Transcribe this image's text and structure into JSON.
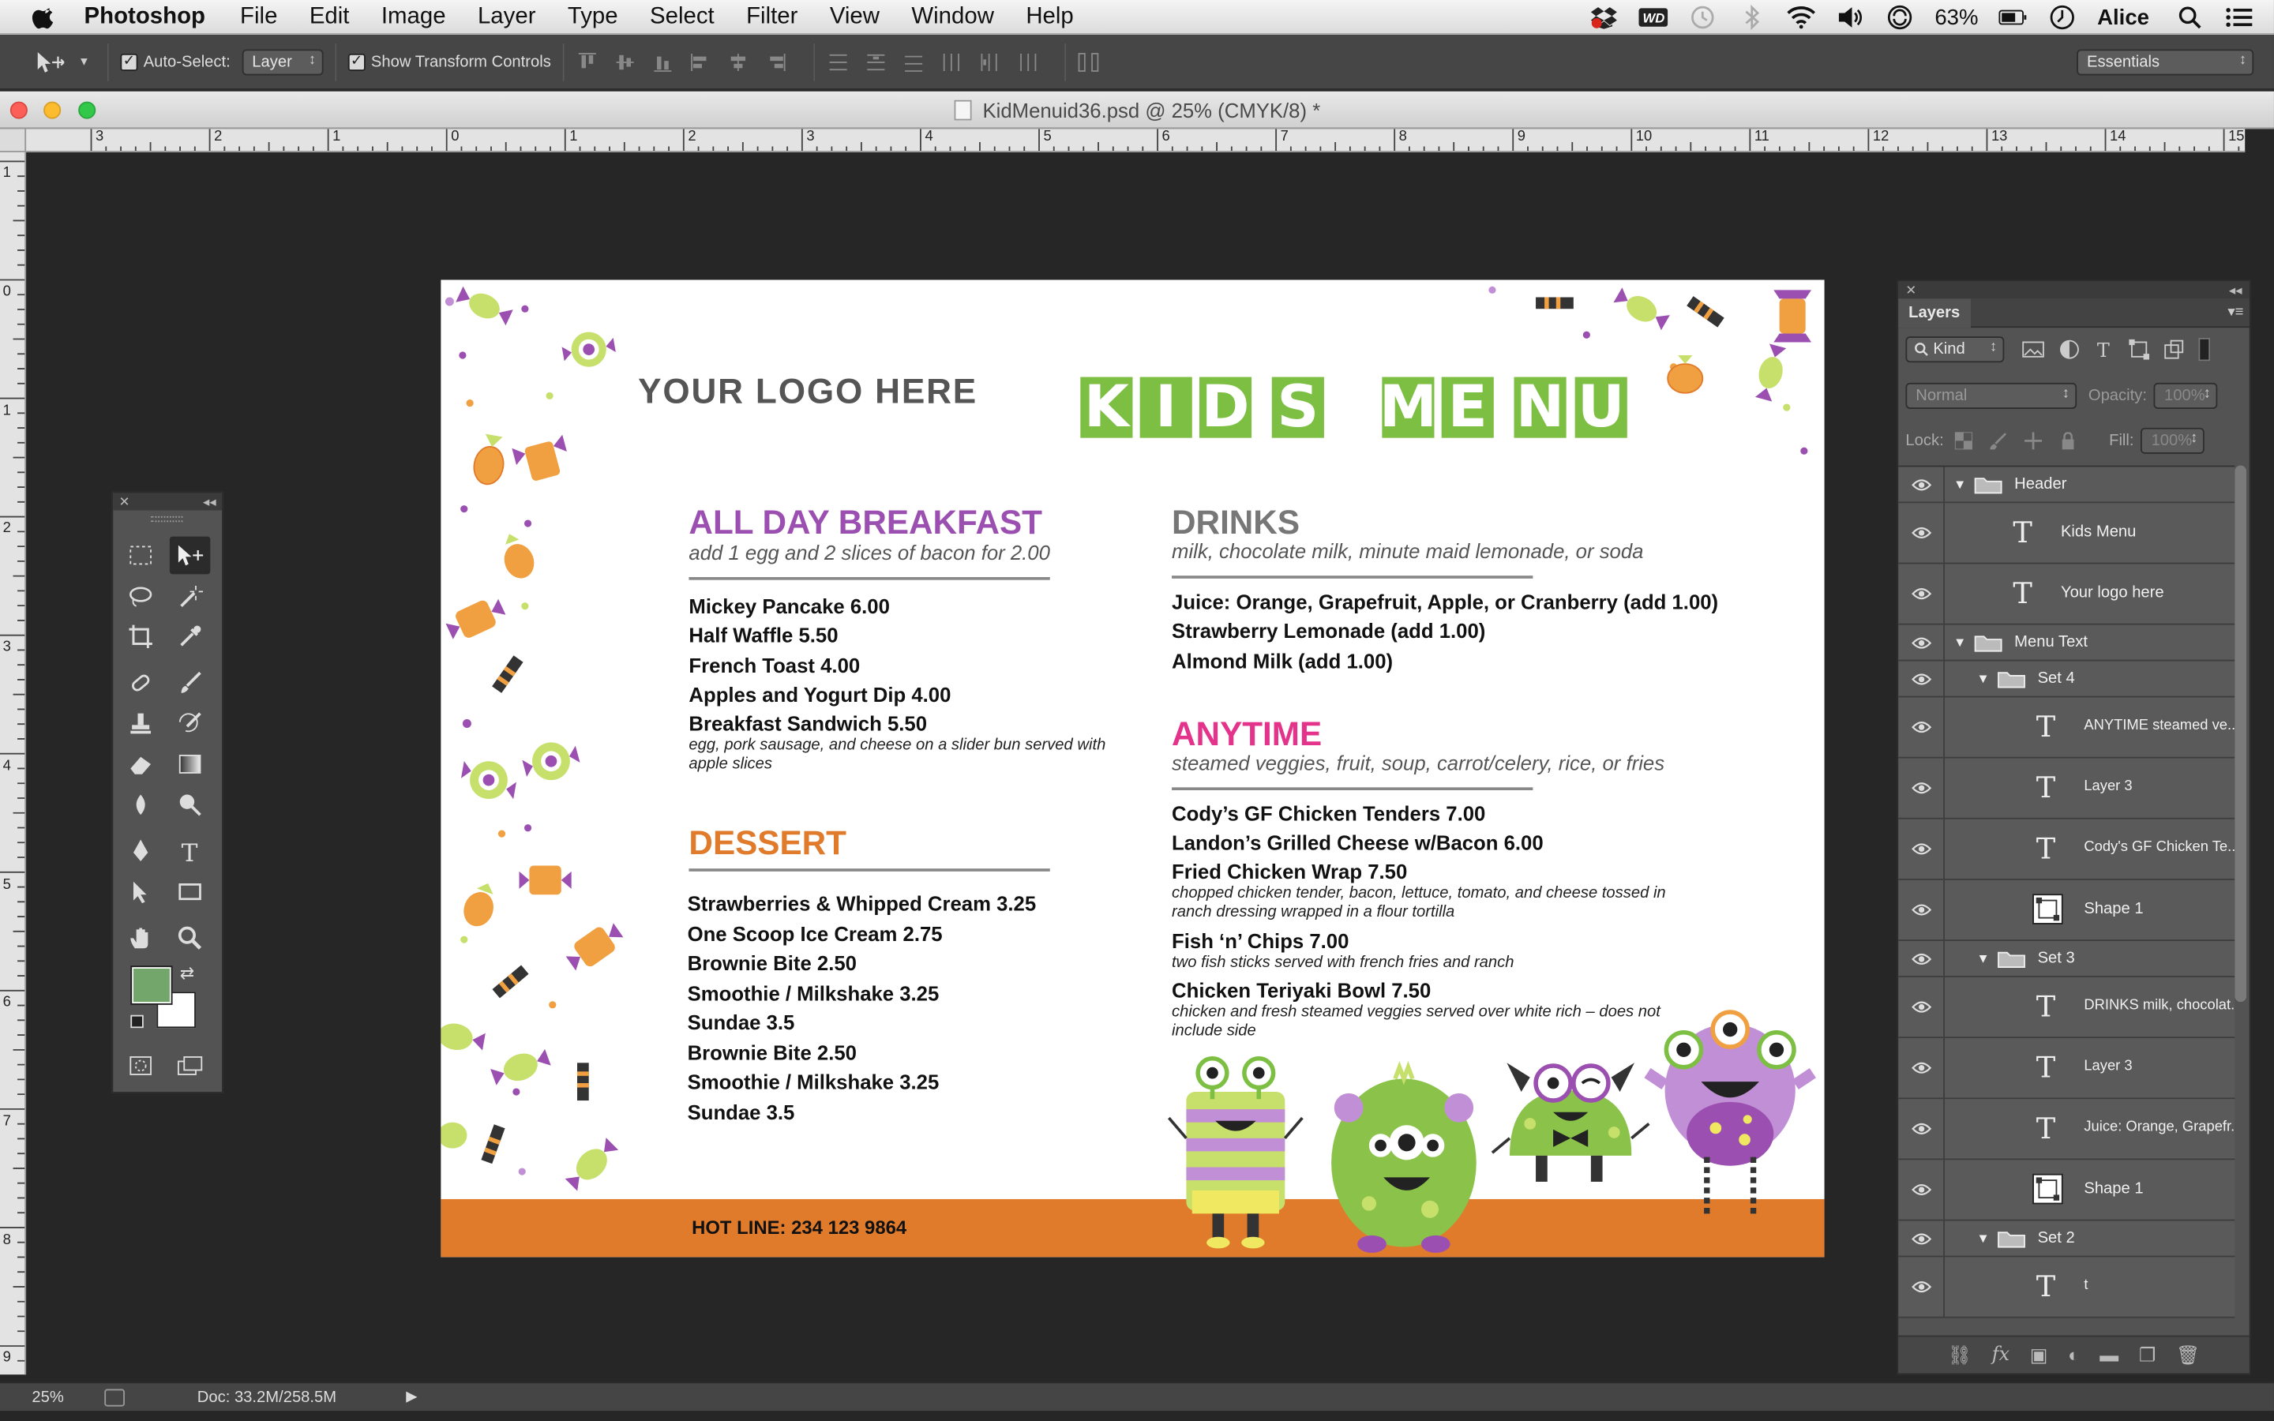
{
  "menubar": {
    "app_name": "Photoshop",
    "items": [
      "File",
      "Edit",
      "Image",
      "Layer",
      "Type",
      "Select",
      "Filter",
      "View",
      "Window",
      "Help"
    ],
    "battery": "63%",
    "user": "Alice"
  },
  "options": {
    "auto_select_label": "Auto-Select:",
    "auto_select_value": "Layer",
    "show_transform_label": "Show Transform Controls",
    "workspace": "Essentials"
  },
  "document": {
    "title": "KidMenuid36.psd @ 25% (CMYK/8) *"
  },
  "rulers": {
    "h_ticks": [
      "3",
      "2",
      "1",
      "0",
      "1",
      "2",
      "3",
      "4",
      "5",
      "6",
      "7",
      "8",
      "9",
      "10",
      "11",
      "12",
      "13",
      "14",
      "15"
    ],
    "v_ticks": [
      "1",
      "0",
      "1",
      "2",
      "3",
      "4",
      "5",
      "6",
      "7",
      "8",
      "9"
    ]
  },
  "menu": {
    "logo": "YOUR LOGO HERE",
    "title_word1": [
      "K",
      "I",
      "D",
      "S"
    ],
    "title_word2": [
      "M",
      "E",
      "N",
      "U"
    ],
    "breakfast": {
      "heading": "ALL DAY BREAKFAST",
      "sub": "add 1 egg and 2 slices of bacon for 2.00",
      "items": [
        "Mickey Pancake  6.00",
        "Half Waffle  5.50",
        "French Toast  4.00",
        "Apples and Yogurt Dip  4.00",
        "Breakfast Sandwich  5.50"
      ],
      "note": "egg, pork sausage, and cheese on a slider bun served with apple slices"
    },
    "dessert": {
      "heading": "DESSERT",
      "items": [
        "Strawberries & Whipped Cream  3.25",
        "One Scoop Ice Cream  2.75",
        "Brownie Bite  2.50",
        "Smoothie / Milkshake  3.25",
        "Sundae 3.5",
        "Brownie Bite  2.50",
        "Smoothie / Milkshake  3.25",
        "Sundae 3.5"
      ]
    },
    "drinks": {
      "heading": "DRINKS",
      "sub": "milk, chocolate milk, minute maid lemonade, or soda",
      "items": [
        "Juice: Orange, Grapefruit, Apple, or Cranberry  (add 1.00)",
        "Strawberry Lemonade (add 1.00)",
        "Almond Milk (add 1.00)"
      ]
    },
    "anytime": {
      "heading": "ANYTIME",
      "sub": "steamed veggies, fruit, soup, carrot/celery, rice, or fries",
      "item1": "Cody’s GF Chicken Tenders 7.00",
      "item2": "Landon’s Grilled Cheese w/Bacon 6.00",
      "item3": "Fried Chicken Wrap  7.50",
      "note3": "chopped chicken tender, bacon, lettuce, tomato, and cheese tossed in ranch dressing wrapped in a flour tortilla",
      "item4": "Fish ‘n’ Chips  7.00",
      "note4": "two fish sticks served with french fries and ranch",
      "item5": "Chicken Teriyaki Bowl 7.50",
      "note5": "chicken and fresh steamed veggies served over white rich – does not include side"
    },
    "hotline": "HOT LINE: 234 123 9864",
    "colors": {
      "purple": "#9b4fb0",
      "gray": "#777777",
      "orange": "#e07b2c",
      "pink": "#e3338a",
      "green": "#7cbf42"
    }
  },
  "layers": {
    "tab": "Layers",
    "kind": "Kind",
    "blend": "Normal",
    "opacity_label": "Opacity:",
    "opacity_value": "100%",
    "lock_label": "Lock:",
    "fill_label": "Fill:",
    "fill_value": "100%",
    "rows": [
      {
        "name": "Header",
        "type": "group"
      },
      {
        "name": "Kids Menu",
        "type": "text"
      },
      {
        "name": "Your logo here",
        "type": "text"
      },
      {
        "name": "Menu Text",
        "type": "group"
      },
      {
        "name": "Set 4",
        "type": "group"
      },
      {
        "name": "ANYTIME steamed ve...",
        "type": "text"
      },
      {
        "name": "Layer 3",
        "type": "text"
      },
      {
        "name": "Cody's GF Chicken Te...",
        "type": "text"
      },
      {
        "name": "Shape 1",
        "type": "shape"
      },
      {
        "name": "Set 3",
        "type": "group"
      },
      {
        "name": "DRINKS milk, chocolat...",
        "type": "text"
      },
      {
        "name": "Layer 3",
        "type": "text"
      },
      {
        "name": "Juice: Orange, Grapefr...",
        "type": "text"
      },
      {
        "name": "Shape 1",
        "type": "shape"
      },
      {
        "name": "Set 2",
        "type": "group"
      },
      {
        "name": "t",
        "type": "text"
      }
    ]
  },
  "status": {
    "zoom": "25%",
    "doc_size": "Doc: 33.2M/258.5M"
  }
}
